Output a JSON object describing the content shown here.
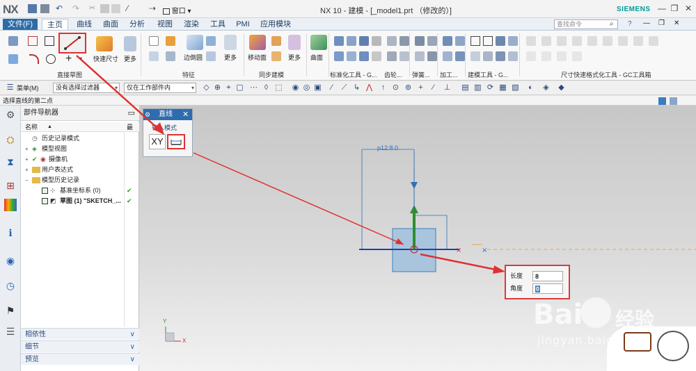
{
  "app": {
    "logo": "NX",
    "title": "NX 10 - 建模 - [_model1.prt （修改的）]",
    "brand": "SIEMENS",
    "window_controls": [
      "—",
      "❐",
      "✕"
    ]
  },
  "menu": {
    "file_tab": "文件(F)",
    "tabs": [
      "主页",
      "曲线",
      "曲面",
      "分析",
      "视图",
      "渲染",
      "工具",
      "PMI",
      "应用模块"
    ],
    "active_tab": "主页",
    "search_placeholder": "查找命令",
    "right_controls": [
      "?",
      "—",
      "❐",
      "✕"
    ]
  },
  "ribbon": {
    "groups": [
      {
        "label": "直接草图"
      },
      {
        "label": "特征"
      },
      {
        "label": "同步建模"
      },
      {
        "label": "标准化工具 - G..."
      },
      {
        "label": "齿轮..."
      },
      {
        "label": "弹簧..."
      },
      {
        "label": "加工..."
      },
      {
        "label": "建模工具 - G..."
      },
      {
        "label": "尺寸快速格式化工具 - GC工具箱"
      }
    ],
    "buttons": {
      "quick_dim": "快速尺寸",
      "more": "更多",
      "edge_blend": "边倒圆",
      "move_face": "移动面",
      "surface": "曲面"
    }
  },
  "toolbar": {
    "menu_label": "菜单(M)",
    "filter": "没有选择过滤器",
    "scope": "仅在工作部件内"
  },
  "status": "选择直线的第二点",
  "navigator": {
    "title": "部件导航器",
    "col_name": "名称",
    "col_recent": "最",
    "items": [
      {
        "label": "历史记录模式",
        "check": ""
      },
      {
        "label": "模型视图",
        "check": ""
      },
      {
        "label": "摄像机",
        "check": ""
      },
      {
        "label": "用户表达式",
        "check": ""
      },
      {
        "label": "模型历史记录",
        "check": ""
      },
      {
        "label": "基准坐标系 (0)",
        "check": "✔"
      },
      {
        "label": "草图 (1) \"SKETCH_...",
        "check": "✔"
      }
    ],
    "panels": [
      "相依性",
      "细节",
      "预览"
    ]
  },
  "dialog": {
    "title": "直线",
    "label_input": "输入模式",
    "xy": "XY"
  },
  "graphics": {
    "dimension": "p12:8.0",
    "triad_x": "X",
    "triad_y": "Y"
  },
  "entry": {
    "length_label": "长度",
    "length_value": "8",
    "angle_label": "角度",
    "angle_value": "0"
  },
  "watermark": {
    "brand": "Bai",
    "brand2": "经验",
    "url": "jingyan.baidu.com"
  },
  "colors": {
    "accent": "#2d6ba5",
    "highlight": "#e03030",
    "check": "#1ea01e",
    "siemens": "#009999"
  }
}
